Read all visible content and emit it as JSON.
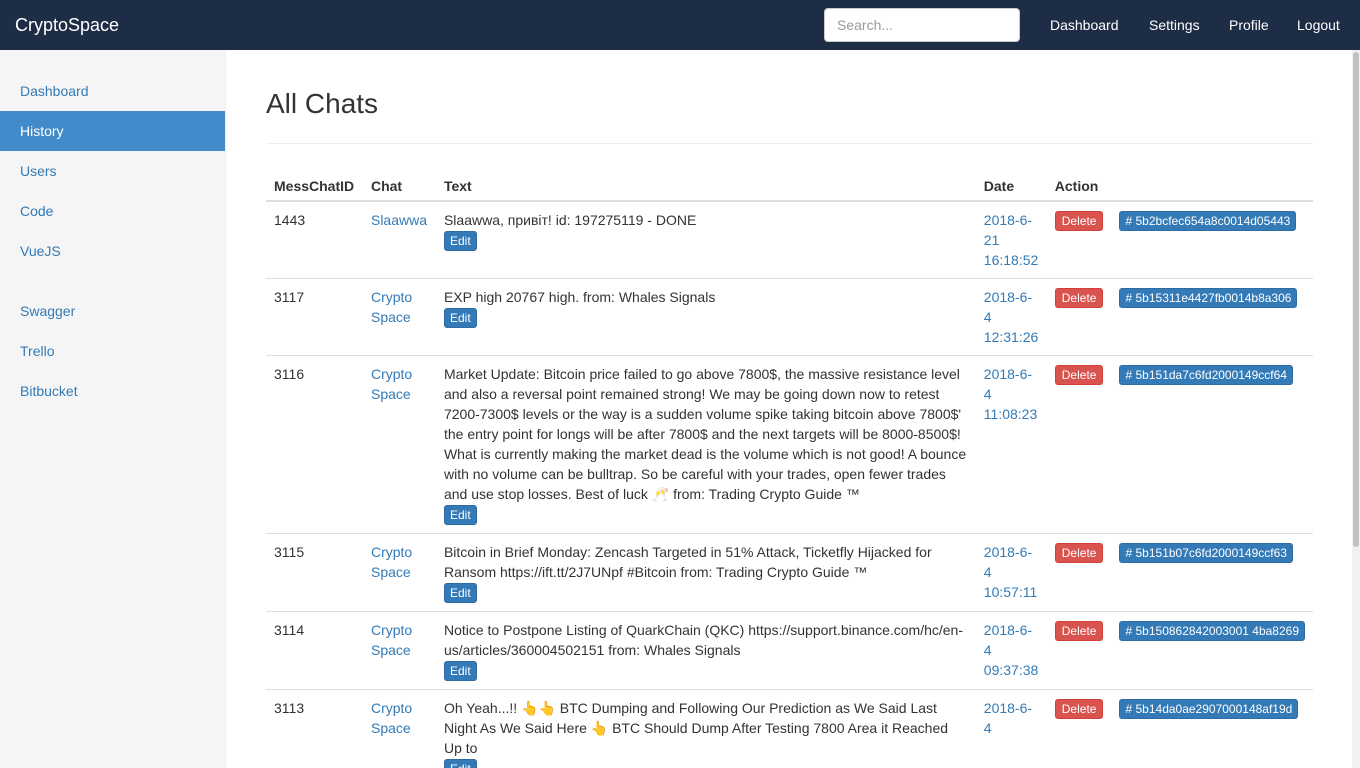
{
  "navbar": {
    "brand": "CryptoSpace",
    "search_placeholder": "Search...",
    "links": [
      "Dashboard",
      "Settings",
      "Profile",
      "Logout"
    ]
  },
  "sidebar": {
    "items": [
      {
        "label": "Dashboard"
      },
      {
        "label": "History",
        "active": true
      },
      {
        "label": "Users"
      },
      {
        "label": "Code"
      },
      {
        "label": "VueJS"
      }
    ],
    "items2": [
      {
        "label": "Swagger"
      },
      {
        "label": "Trello"
      },
      {
        "label": "Bitbucket"
      }
    ]
  },
  "main": {
    "title": "All Chats",
    "columns": [
      "MessChatID",
      "Chat",
      "Text",
      "Date",
      "Action"
    ],
    "rows": [
      {
        "id": "1443",
        "chat": "Slaawwa",
        "text": "Slaawwa, привіт! id: 197275119 - DONE",
        "edit": "Edit",
        "date": "2018-6-21 16:18:52",
        "delete": "Delete",
        "hash": "# 5b2bcfec654a8c0014d05443"
      },
      {
        "id": "3117",
        "chat": "Crypto Space",
        "text": "EXP high 20767 high. from: Whales Signals",
        "edit": "Edit",
        "date": "2018-6-4 12:31:26",
        "delete": "Delete",
        "hash": "# 5b15311e4427fb0014b8a306"
      },
      {
        "id": "3116",
        "chat": "Crypto Space",
        "text": "Market Update: Bitcoin price failed to go above 7800$, the massive resistance level and also a reversal point remained strong! We may be going down now to retest 7200-7300$ levels or the way is a sudden volume spike taking bitcoin above 7800$' the entry point for longs will be after 7800$ and the next targets will be 8000-8500$! What is currently making the market dead is the volume which is not good! A bounce with no volume can be bulltrap. So be careful with your trades, open fewer trades and use stop losses. Best of luck 🥂 from: Trading Crypto Guide ™",
        "edit": "Edit",
        "date": "2018-6-4 11:08:23",
        "delete": "Delete",
        "hash": "# 5b151da7c6fd2000149ccf64"
      },
      {
        "id": "3115",
        "chat": "Crypto Space",
        "text": "Bitcoin in Brief Monday: Zencash Targeted in 51% Attack, Ticketfly Hijacked for Ransom https://ift.tt/2J7UNpf #Bitcoin from: Trading Crypto Guide ™",
        "edit": "Edit",
        "date": "2018-6-4 10:57:11",
        "delete": "Delete",
        "hash": "# 5b151b07c6fd2000149ccf63"
      },
      {
        "id": "3114",
        "chat": "Crypto Space",
        "text": "Notice to Postpone Listing of QuarkChain (QKC) https://support.binance.com/hc/en-us/articles/360004502151 from: Whales Signals",
        "edit": "Edit",
        "date": "2018-6-4 09:37:38",
        "delete": "Delete",
        "hash": "# 5b150862842003001 4ba8269"
      },
      {
        "id": "3113",
        "chat": "Crypto Space",
        "text": "Oh Yeah...!! 👆👆 BTC Dumping and Following Our Prediction as We Said Last Night As We Said Here 👆 BTC Should Dump After Testing 7800 Area it Reached Up to",
        "edit": "Edit",
        "date": "2018-6-4",
        "delete": "Delete",
        "hash": "# 5b14da0ae2907000148af19d"
      }
    ]
  }
}
